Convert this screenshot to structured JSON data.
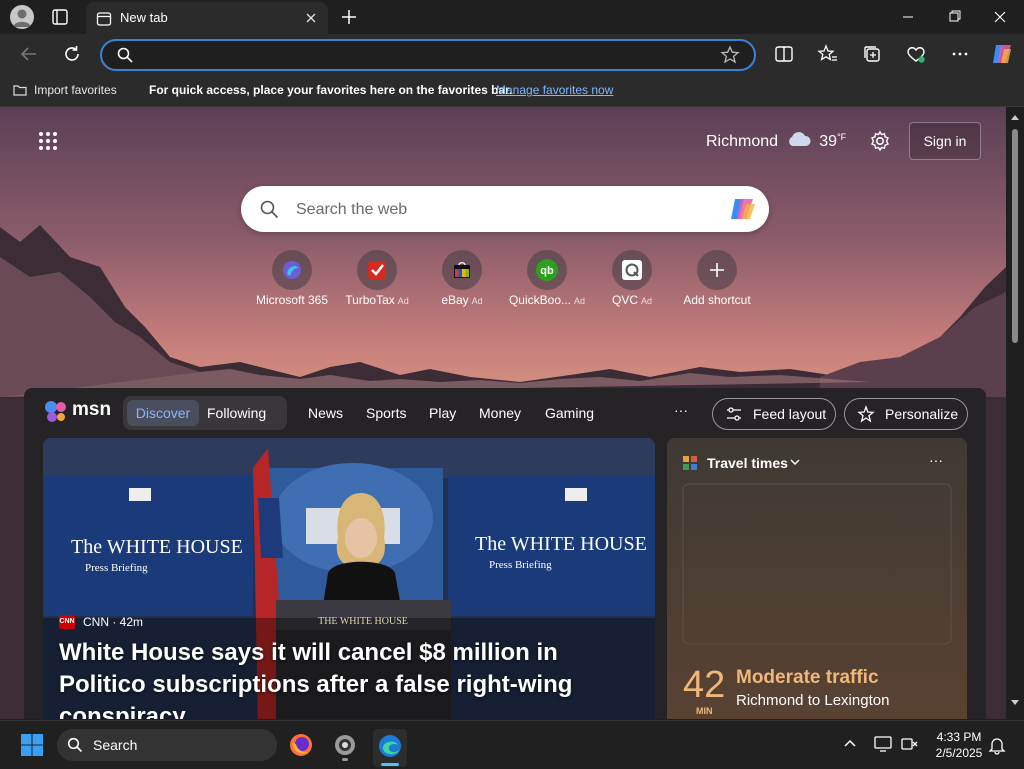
{
  "tab": {
    "title": "New tab"
  },
  "favorites_bar": {
    "import_label": "Import favorites",
    "message": "For quick access, place your favorites here on the favorites bar.",
    "manage_link": "Manage favorites now"
  },
  "header": {
    "city": "Richmond",
    "temperature": "39",
    "temp_unit": "°F",
    "sign_in": "Sign in"
  },
  "search": {
    "placeholder": "Search the web"
  },
  "shortcuts": [
    {
      "label": "Microsoft 365",
      "ad": ""
    },
    {
      "label": "TurboTax",
      "ad": "Ad"
    },
    {
      "label": "eBay",
      "ad": "Ad"
    },
    {
      "label": "QuickBoo...",
      "ad": "Ad"
    },
    {
      "label": "QVC",
      "ad": "Ad"
    },
    {
      "label": "Add shortcut",
      "ad": ""
    }
  ],
  "feed": {
    "brand": "msn",
    "discover": "Discover",
    "following": "Following",
    "nav": [
      "News",
      "Sports",
      "Play",
      "Money",
      "Gaming"
    ],
    "more": "···",
    "feed_layout": "Feed layout",
    "personalize": "Personalize",
    "hero": {
      "source": "CNN",
      "age": "· 42m",
      "logo_text": "CNN",
      "headline": "White House says it will cancel $8 million in Politico subscriptions after a false right-wing conspiracy...",
      "screen_title_1": "The WHITE HOUSE",
      "screen_sub": "Press Briefing",
      "podium": "THE WHITE HOUSE"
    },
    "travel": {
      "title": "Travel times",
      "more": "···",
      "minutes": "42",
      "unit": "MIN",
      "status": "Moderate traffic",
      "route": "Richmond to Lexington"
    }
  },
  "taskbar": {
    "search_label": "Search",
    "time": "4:33 PM",
    "date": "2/5/2025"
  },
  "colors": {
    "accent": "#3a82d6",
    "link": "#7eb8ff",
    "traffic": "#f0b77a"
  }
}
